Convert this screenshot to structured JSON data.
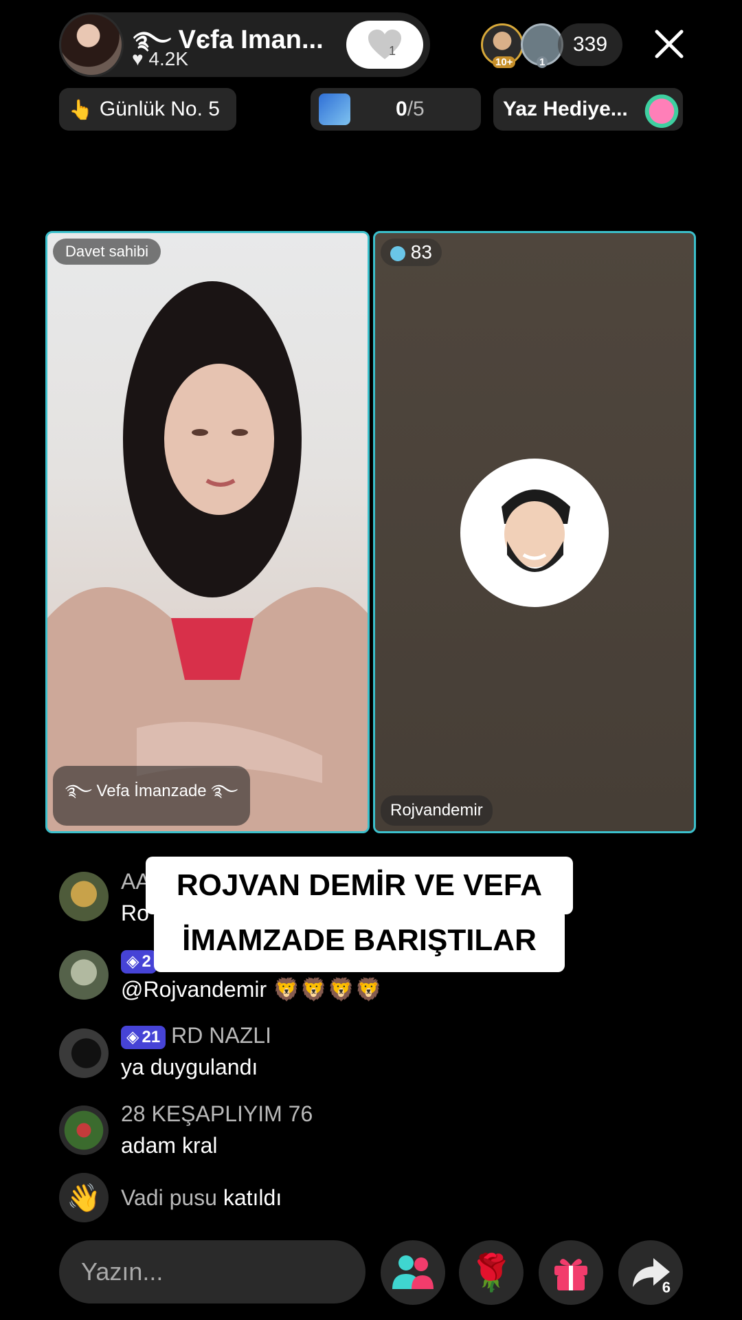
{
  "header": {
    "host_name": "Vєfa Iman...",
    "likes": "4.2K",
    "follow_count": "1",
    "viewer_badges": [
      "10+",
      "1"
    ],
    "viewer_count": "339"
  },
  "pills": {
    "daily_rank": "Günlük No. 5",
    "goal_progress_done": "0",
    "goal_progress_total": "/5",
    "gift_event": "Yaz Hediye..."
  },
  "panels": {
    "left_host_tag": "Davet sahibi",
    "left_name_tag": "Vefa İmanzade",
    "right_score": "83",
    "right_name_tag": "Rojvandemir"
  },
  "caption": {
    "line1": "ROJVAN DEMİR VE VEFA",
    "line2": "İMAMZADE BARIŞTILAR"
  },
  "chat": {
    "c1_name_partial": "AA",
    "c1_msg_partial": "Ro",
    "c2_level_partial": "2",
    "c2_msg": "@Rojvandemir 🦁🦁🦁🦁",
    "c3_level": "21",
    "c3_name": "RD NAZLI",
    "c3_msg": "ya duygulandı",
    "c4_name": "28 KEŞAPLIYIM 76",
    "c4_msg": "adam kral",
    "join_user": "Vadi pusu",
    "join_text": "katıldı"
  },
  "bottom": {
    "input_placeholder": "Yazın...",
    "share_count": "6"
  },
  "colors": {
    "panel_border": "#3bc0cc",
    "level_badge": "#4643d6",
    "gift_pink": "#f23c6c"
  }
}
